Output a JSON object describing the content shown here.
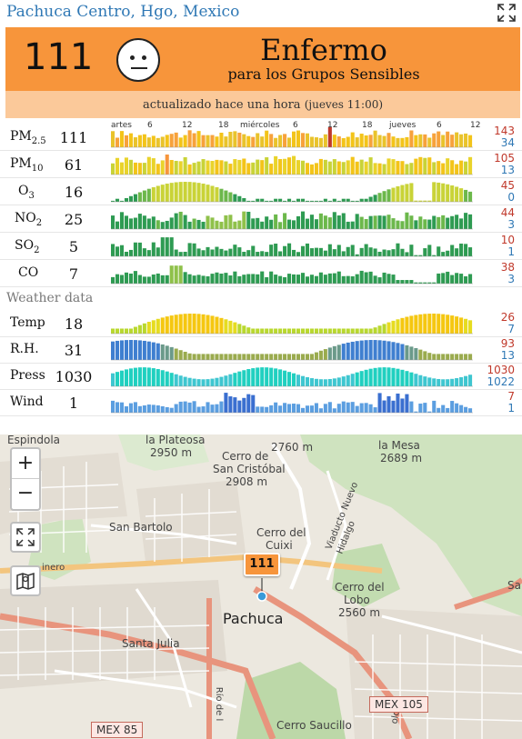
{
  "header": {
    "station": "Pachuca Centro, Hgo, Mexico"
  },
  "aqi": {
    "value": "111",
    "status": "Enfermo",
    "status_sub": "para los Grupos Sensibles"
  },
  "updated": {
    "text": "actualizado hace una hora",
    "when": "(jueves 11:00)"
  },
  "timeline": {
    "ticks": [
      {
        "label": "artes",
        "day": true
      },
      {
        "label": "6",
        "day": false
      },
      {
        "label": "12",
        "day": false
      },
      {
        "label": "18",
        "day": false
      },
      {
        "label": "miércoles",
        "day": true
      },
      {
        "label": "6",
        "day": false
      },
      {
        "label": "12",
        "day": false
      },
      {
        "label": "18",
        "day": false
      },
      {
        "label": "jueves",
        "day": true
      },
      {
        "label": "6",
        "day": false
      },
      {
        "label": "12",
        "day": false
      }
    ]
  },
  "pollutants": [
    {
      "id": "pm25",
      "name": "PM",
      "sub": "2.5",
      "value": "111",
      "max": "143",
      "min": "34"
    },
    {
      "id": "pm10",
      "name": "PM",
      "sub": "10",
      "value": "61",
      "max": "105",
      "min": "13"
    },
    {
      "id": "o3",
      "name": "O",
      "sub": "3",
      "value": "16",
      "max": "45",
      "min": "0"
    },
    {
      "id": "no2",
      "name": "NO",
      "sub": "2",
      "value": "25",
      "max": "44",
      "min": "3"
    },
    {
      "id": "so2",
      "name": "SO",
      "sub": "2",
      "value": "5",
      "max": "10",
      "min": "1"
    },
    {
      "id": "co",
      "name": "CO",
      "sub": "",
      "value": "7",
      "max": "38",
      "min": "3"
    }
  ],
  "weather": {
    "title": "Weather data",
    "rows": [
      {
        "id": "temp",
        "name": "Temp",
        "value": "18",
        "max": "26",
        "min": "7"
      },
      {
        "id": "rh",
        "name": "R.H.",
        "value": "31",
        "max": "93",
        "min": "13"
      },
      {
        "id": "press",
        "name": "Press",
        "value": "1030",
        "max": "1030",
        "min": "1022"
      },
      {
        "id": "wind",
        "name": "Wind",
        "value": "1",
        "max": "7",
        "min": "1"
      }
    ]
  },
  "colors": {
    "accent": "#f7953b",
    "link": "#2f78b5",
    "max": "#c0392b",
    "min": "#2f78b5"
  },
  "map": {
    "marker": "111",
    "zoom_in": "+",
    "zoom_out": "−",
    "labels": {
      "espindola": "Espindola",
      "plateosa": "la Plateosa",
      "plateosa_elev": "2950 m",
      "elev_2760": "2760 m",
      "la_mesa": "la Mesa",
      "la_mesa_elev": "2689 m",
      "cerro_sc": "Cerro de",
      "cerro_sc2": "San Cristóbal",
      "cerro_sc_elev": "2908 m",
      "san_bartolo": "San Bartolo",
      "cerro_cuixi": "Cerro del",
      "cerro_cuixi2": "Cuixi",
      "viaducto": "Viaducto Nuevo Hidalgo",
      "cerro_lobo": "Cerro del",
      "cerro_lobo2": "Lobo",
      "cerro_lobo_elev": "2560 m",
      "pachuca": "Pachuca",
      "santa_julia": "Santa Julia",
      "mex85": "MEX 85",
      "mex105": "MEX 105",
      "cerro_saucillo": "Cerro Saucillo",
      "rio_de": "Río de l",
      "inero": "inero",
      "sa": "Sa",
      "olojo": "olojo"
    }
  }
}
